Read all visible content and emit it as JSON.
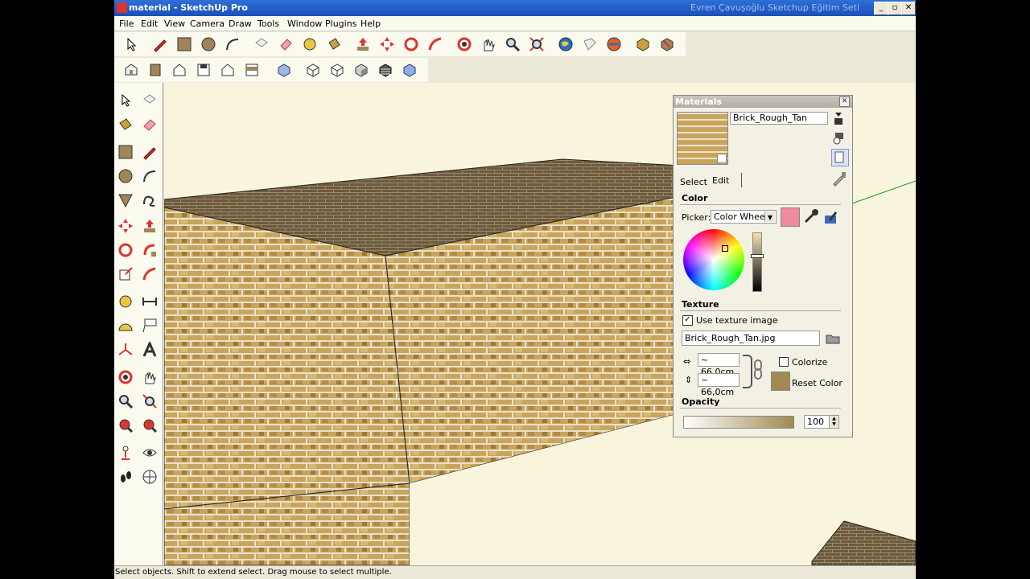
{
  "window": {
    "title": "material - SketchUp Pro",
    "caption": "Evren Çavuşoğlu Sketchup Eğitim Seti"
  },
  "menu": [
    "File",
    "Edit",
    "View",
    "Camera",
    "Draw",
    "Tools",
    "Window",
    "Plugins",
    "Help"
  ],
  "status": {
    "text": "Select objects. Shift to extend select. Drag mouse to select multiple."
  },
  "materials": {
    "panel_title": "Materials",
    "material_name": "Brick_Rough_Tan",
    "tabs": {
      "select": "Select",
      "edit": "Edit"
    },
    "color": {
      "section": "Color",
      "picker_label": "Picker:",
      "picker_value": "Color Wheel",
      "swatch_color": "#f08aa0"
    },
    "texture": {
      "section": "Texture",
      "use_texture_label": "Use texture image",
      "use_texture_checked": true,
      "filename": "Brick_Rough_Tan.jpg",
      "width": "~ 66,0cm",
      "height": "~ 66,0cm",
      "colorize_label": "Colorize",
      "reset_label": "Reset Color",
      "reset_swatch_color": "#a08a50"
    },
    "opacity": {
      "section": "Opacity",
      "value": "100"
    }
  }
}
